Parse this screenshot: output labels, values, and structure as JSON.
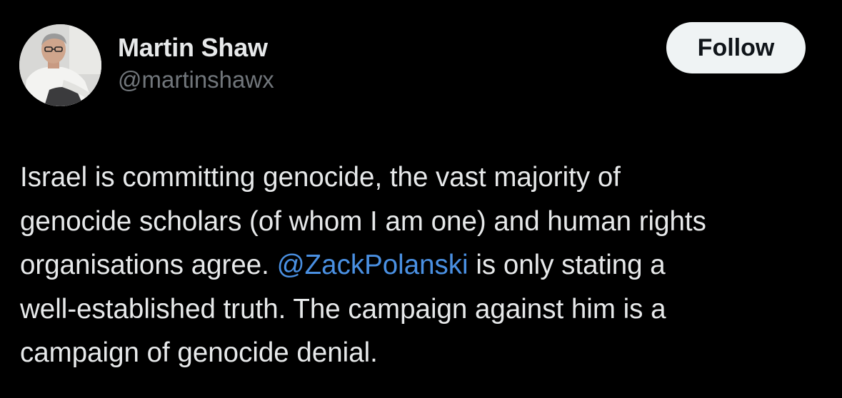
{
  "author": {
    "display_name": "Martin Shaw",
    "handle": "@martinshawx",
    "avatar_icon": "profile-photo"
  },
  "follow_label": "Follow",
  "tweet": {
    "line1": "Israel is committing genocide, the vast majority of",
    "line2": "genocide scholars (of whom I am one) and human rights",
    "line3_before": "organisations agree. ",
    "mention": "@ZackPolanski",
    "line3_after": " is only stating a",
    "line4": "well-established truth. The campaign against him is a",
    "line5": "campaign of genocide denial."
  },
  "colors": {
    "background": "#000000",
    "text": "#e7e9ea",
    "secondary_text": "#71767b",
    "mention": "#4a90e2",
    "button_bg": "#eff3f4",
    "button_text": "#0f1419"
  }
}
